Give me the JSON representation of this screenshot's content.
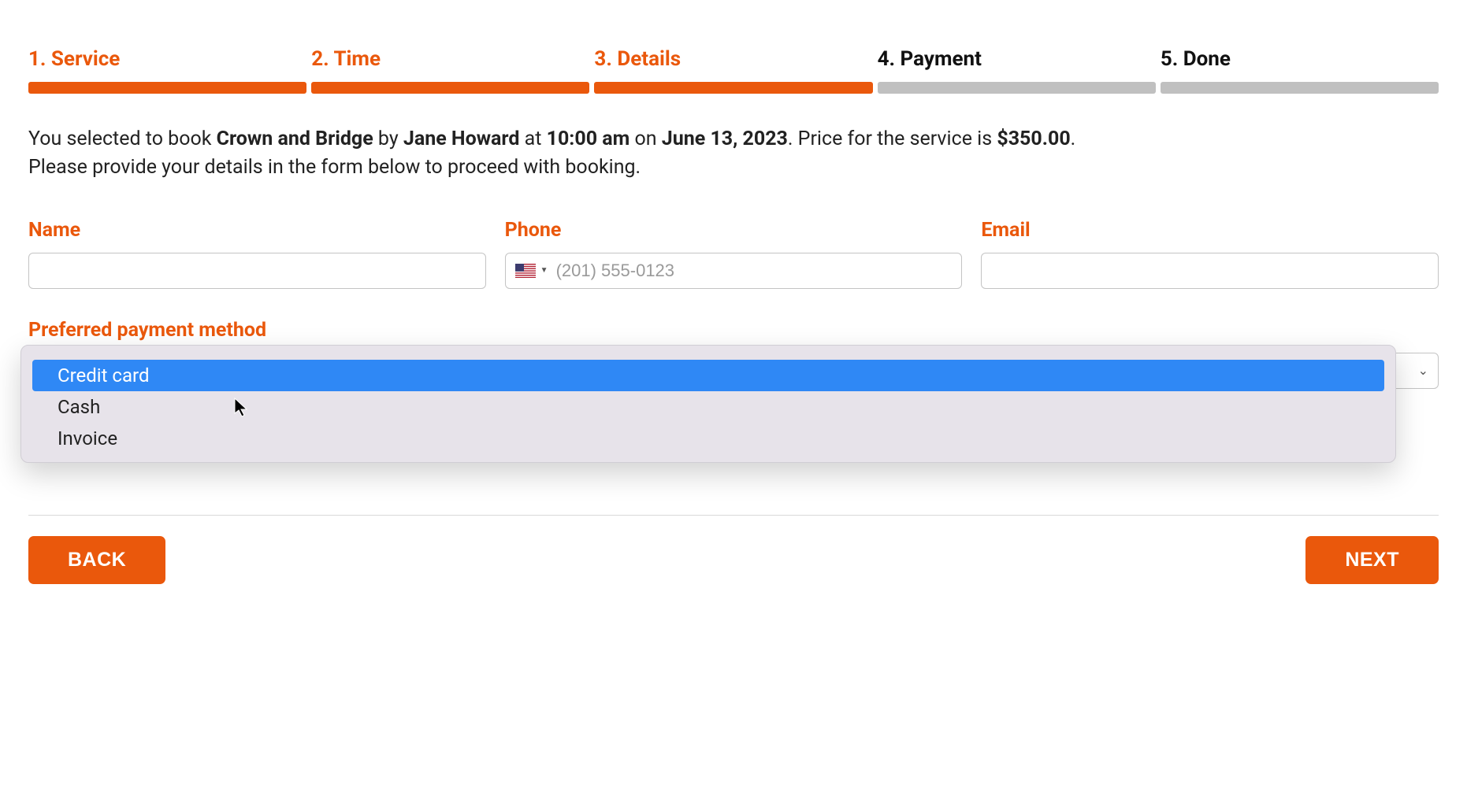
{
  "progress": {
    "steps": [
      {
        "label": "1. Service",
        "status": "completed"
      },
      {
        "label": "2. Time",
        "status": "completed"
      },
      {
        "label": "3. Details",
        "status": "completed"
      },
      {
        "label": "4. Payment",
        "status": "pending"
      },
      {
        "label": "5. Done",
        "status": "pending"
      }
    ]
  },
  "summary": {
    "prefix": "You selected to book ",
    "service": "Crown and Bridge",
    "by_text": " by ",
    "provider": "Jane Howard",
    "at_text": " at ",
    "time": "10:00 am",
    "on_text": " on ",
    "date": "June 13, 2023",
    "price_prefix": ". Price for the service is ",
    "price": "$350.00",
    "period": ".",
    "line2": "Please provide your details in the form below to proceed with booking."
  },
  "form": {
    "name": {
      "label": "Name",
      "value": ""
    },
    "phone": {
      "label": "Phone",
      "placeholder": "(201) 555-0123",
      "value": "",
      "country": "US"
    },
    "email": {
      "label": "Email",
      "value": ""
    },
    "payment": {
      "label": "Preferred payment method",
      "options": [
        "",
        "Credit card",
        "Cash",
        "Invoice"
      ],
      "selected": "",
      "highlighted": "Credit card"
    }
  },
  "buttons": {
    "back": "BACK",
    "next": "NEXT"
  }
}
